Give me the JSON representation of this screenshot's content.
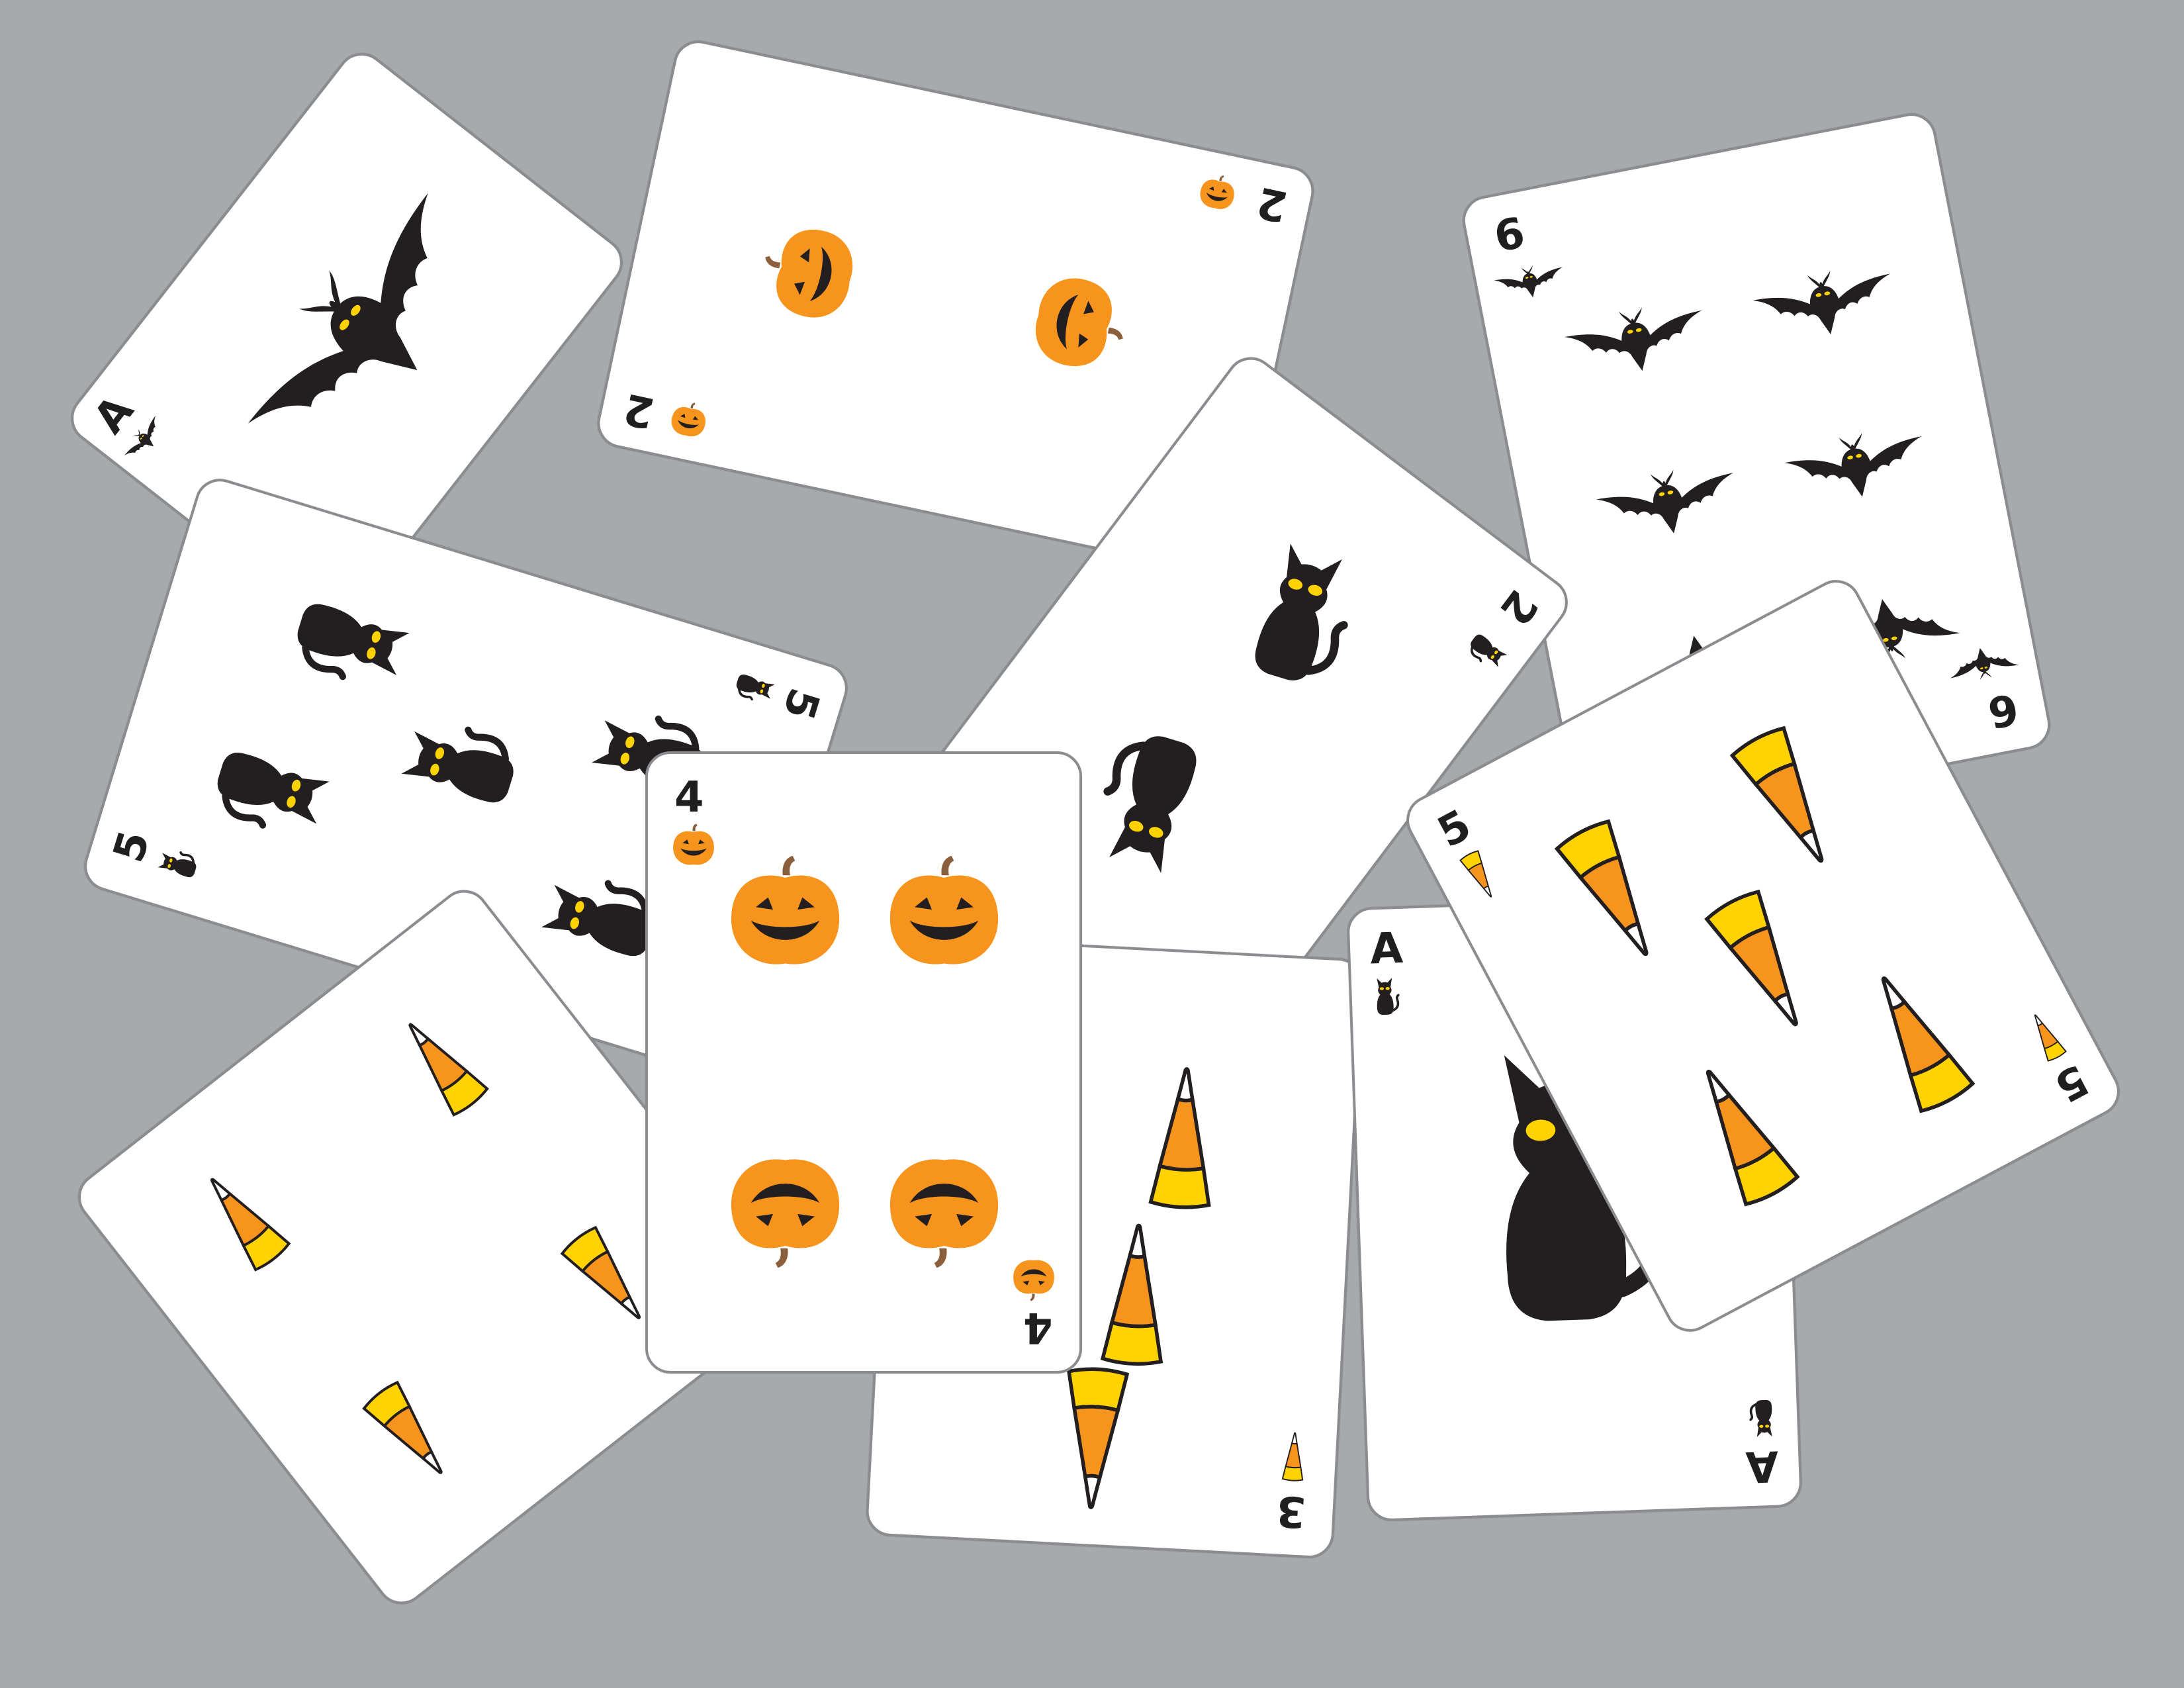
{
  "theme": {
    "background": "#a7a9ac",
    "card_fill": "#ffffff",
    "card_border": "#8a8c8f",
    "pumpkin": "#f7941d",
    "pumpkin_face": "#231f20",
    "candy_yellow": "#ffd200",
    "candy_orange": "#f7941d",
    "candy_white": "#ffffff",
    "silhouette": "#231f20",
    "eye": "#ffd200"
  },
  "cards": [
    {
      "id": "ace-bats",
      "rank": "A",
      "suit": "bat-icon",
      "pips": 1
    },
    {
      "id": "two-pumpkins",
      "rank": "2",
      "suit": "pumpkin-icon",
      "pips": 2
    },
    {
      "id": "six-bats",
      "rank": "6",
      "suit": "bat-icon",
      "pips": 6
    },
    {
      "id": "two-cats",
      "rank": "2",
      "suit": "cat-icon",
      "pips": 2
    },
    {
      "id": "five-cats",
      "rank": "5",
      "suit": "cat-icon",
      "pips": 5
    },
    {
      "id": "five-candy",
      "rank": "5",
      "suit": "candy-corn-icon",
      "pips": 5
    },
    {
      "id": "four-candy",
      "rank": "4",
      "suit": "candy-corn-icon",
      "pips": 4
    },
    {
      "id": "three-candy",
      "rank": "3",
      "suit": "candy-corn-icon",
      "pips": 3
    },
    {
      "id": "ace-cats",
      "rank": "A",
      "suit": "cat-icon",
      "pips": 1
    },
    {
      "id": "four-pumpkins",
      "rank": "4",
      "suit": "pumpkin-icon",
      "pips": 4
    }
  ]
}
